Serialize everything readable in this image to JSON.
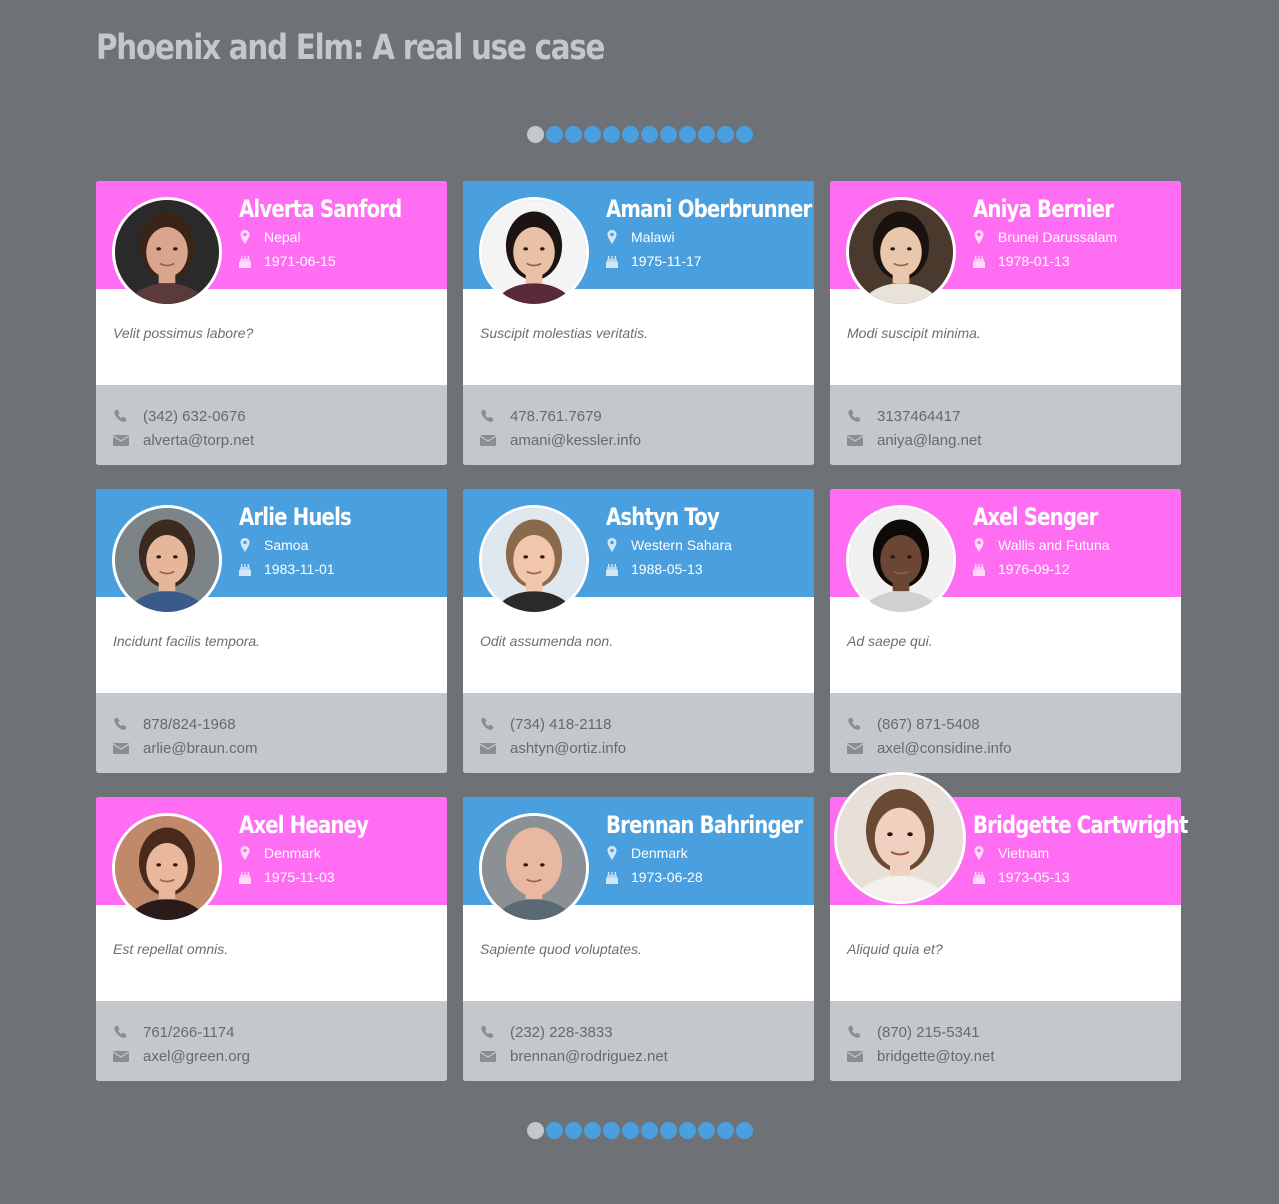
{
  "title": "Phoenix and Elm: A real use case",
  "pagination": {
    "pages": [
      "1",
      "2",
      "3",
      "4",
      "5",
      "6",
      "7",
      "8",
      "9",
      "10",
      "11",
      "12"
    ],
    "active_index": 0
  },
  "colors": {
    "pink": "#ff6ef2",
    "blue": "#4aa0de",
    "background": "#6e7175",
    "footer": "#c4c8cd"
  },
  "icons": {
    "location": "map-marker-icon",
    "birthday": "birthday-cake-icon",
    "phone": "phone-icon",
    "email": "envelope-icon"
  },
  "contacts": [
    {
      "name": "Alverta Sanford",
      "location": "Nepal",
      "birth_date": "1971-06-15",
      "headline": "Velit possimus labore?",
      "phone": "(342) 632-0676",
      "email": "alverta@torp.net",
      "color": "pink",
      "avatar": {
        "skin": "#d9a58f",
        "hair": "#3a2418",
        "bg": "#2a2a2a",
        "shirt": "#5a3a3a"
      }
    },
    {
      "name": "Amani Oberbrunner",
      "location": "Malawi",
      "birth_date": "1975-11-17",
      "headline": "Suscipit molestias veritatis.",
      "phone": "478.761.7679",
      "email": "amani@kessler.info",
      "color": "blue",
      "avatar": {
        "skin": "#e8c1a6",
        "hair": "#1c1410",
        "bg": "#f4f4f4",
        "shirt": "#5b2a3a"
      }
    },
    {
      "name": "Aniya Bernier",
      "location": "Brunei Darussalam",
      "birth_date": "1978-01-13",
      "headline": "Modi suscipit minima.",
      "phone": "3137464417",
      "email": "aniya@lang.net",
      "color": "pink",
      "avatar": {
        "skin": "#e9c7ad",
        "hair": "#1a120e",
        "bg": "#4a3a2e",
        "shirt": "#e8e2d8"
      }
    },
    {
      "name": "Arlie Huels",
      "location": "Samoa",
      "birth_date": "1983-11-01",
      "headline": "Incidunt facilis tempora.",
      "phone": "878/824-1968",
      "email": "arlie@braun.com",
      "color": "blue",
      "avatar": {
        "skin": "#e6b69b",
        "hair": "#3a2a20",
        "bg": "#7c8488",
        "shirt": "#3a5a8a"
      }
    },
    {
      "name": "Ashtyn Toy",
      "location": "Western Sahara",
      "birth_date": "1988-05-13",
      "headline": "Odit assumenda non.",
      "phone": "(734) 418-2118",
      "email": "ashtyn@ortiz.info",
      "color": "blue",
      "avatar": {
        "skin": "#f0c7aa",
        "hair": "#8a6a4a",
        "bg": "#dfe8ee",
        "shirt": "#2a2a2a"
      }
    },
    {
      "name": "Axel Senger",
      "location": "Wallis and Futuna",
      "birth_date": "1976-09-12",
      "headline": "Ad saepe qui.",
      "phone": "(867) 871-5408",
      "email": "axel@considine.info",
      "color": "pink",
      "avatar": {
        "skin": "#6b4634",
        "hair": "#0e0a08",
        "bg": "#f0f0f0",
        "shirt": "#d0d0d0"
      }
    },
    {
      "name": "Axel Heaney",
      "location": "Denmark",
      "birth_date": "1975-11-03",
      "headline": "Est repellat omnis.",
      "phone": "761/266-1174",
      "email": "axel@green.org",
      "color": "pink",
      "avatar": {
        "skin": "#e8b79c",
        "hair": "#4a2a1a",
        "bg": "#c08a6a",
        "shirt": "#2a1a1a"
      }
    },
    {
      "name": "Brennan Bahringer",
      "location": "Denmark",
      "birth_date": "1973-06-28",
      "headline": "Sapiente quod voluptates.",
      "phone": "(232) 228-3833",
      "email": "brennan@rodriguez.net",
      "color": "blue",
      "avatar": {
        "skin": "#e9b8a0",
        "hair": "#e9b8a0",
        "bg": "#8a9094",
        "shirt": "#5a6a74"
      }
    },
    {
      "name": "Bridgette Cartwright",
      "location": "Vietnam",
      "birth_date": "1973-05-13",
      "headline": "Aliquid quia et?",
      "phone": "(870) 215-5341",
      "email": "bridgette@toy.net",
      "color": "pink",
      "big_avatar": true,
      "avatar": {
        "skin": "#f0d0be",
        "hair": "#6a4a34",
        "bg": "#e8e0d8",
        "shirt": "#f4f0ec"
      }
    }
  ]
}
